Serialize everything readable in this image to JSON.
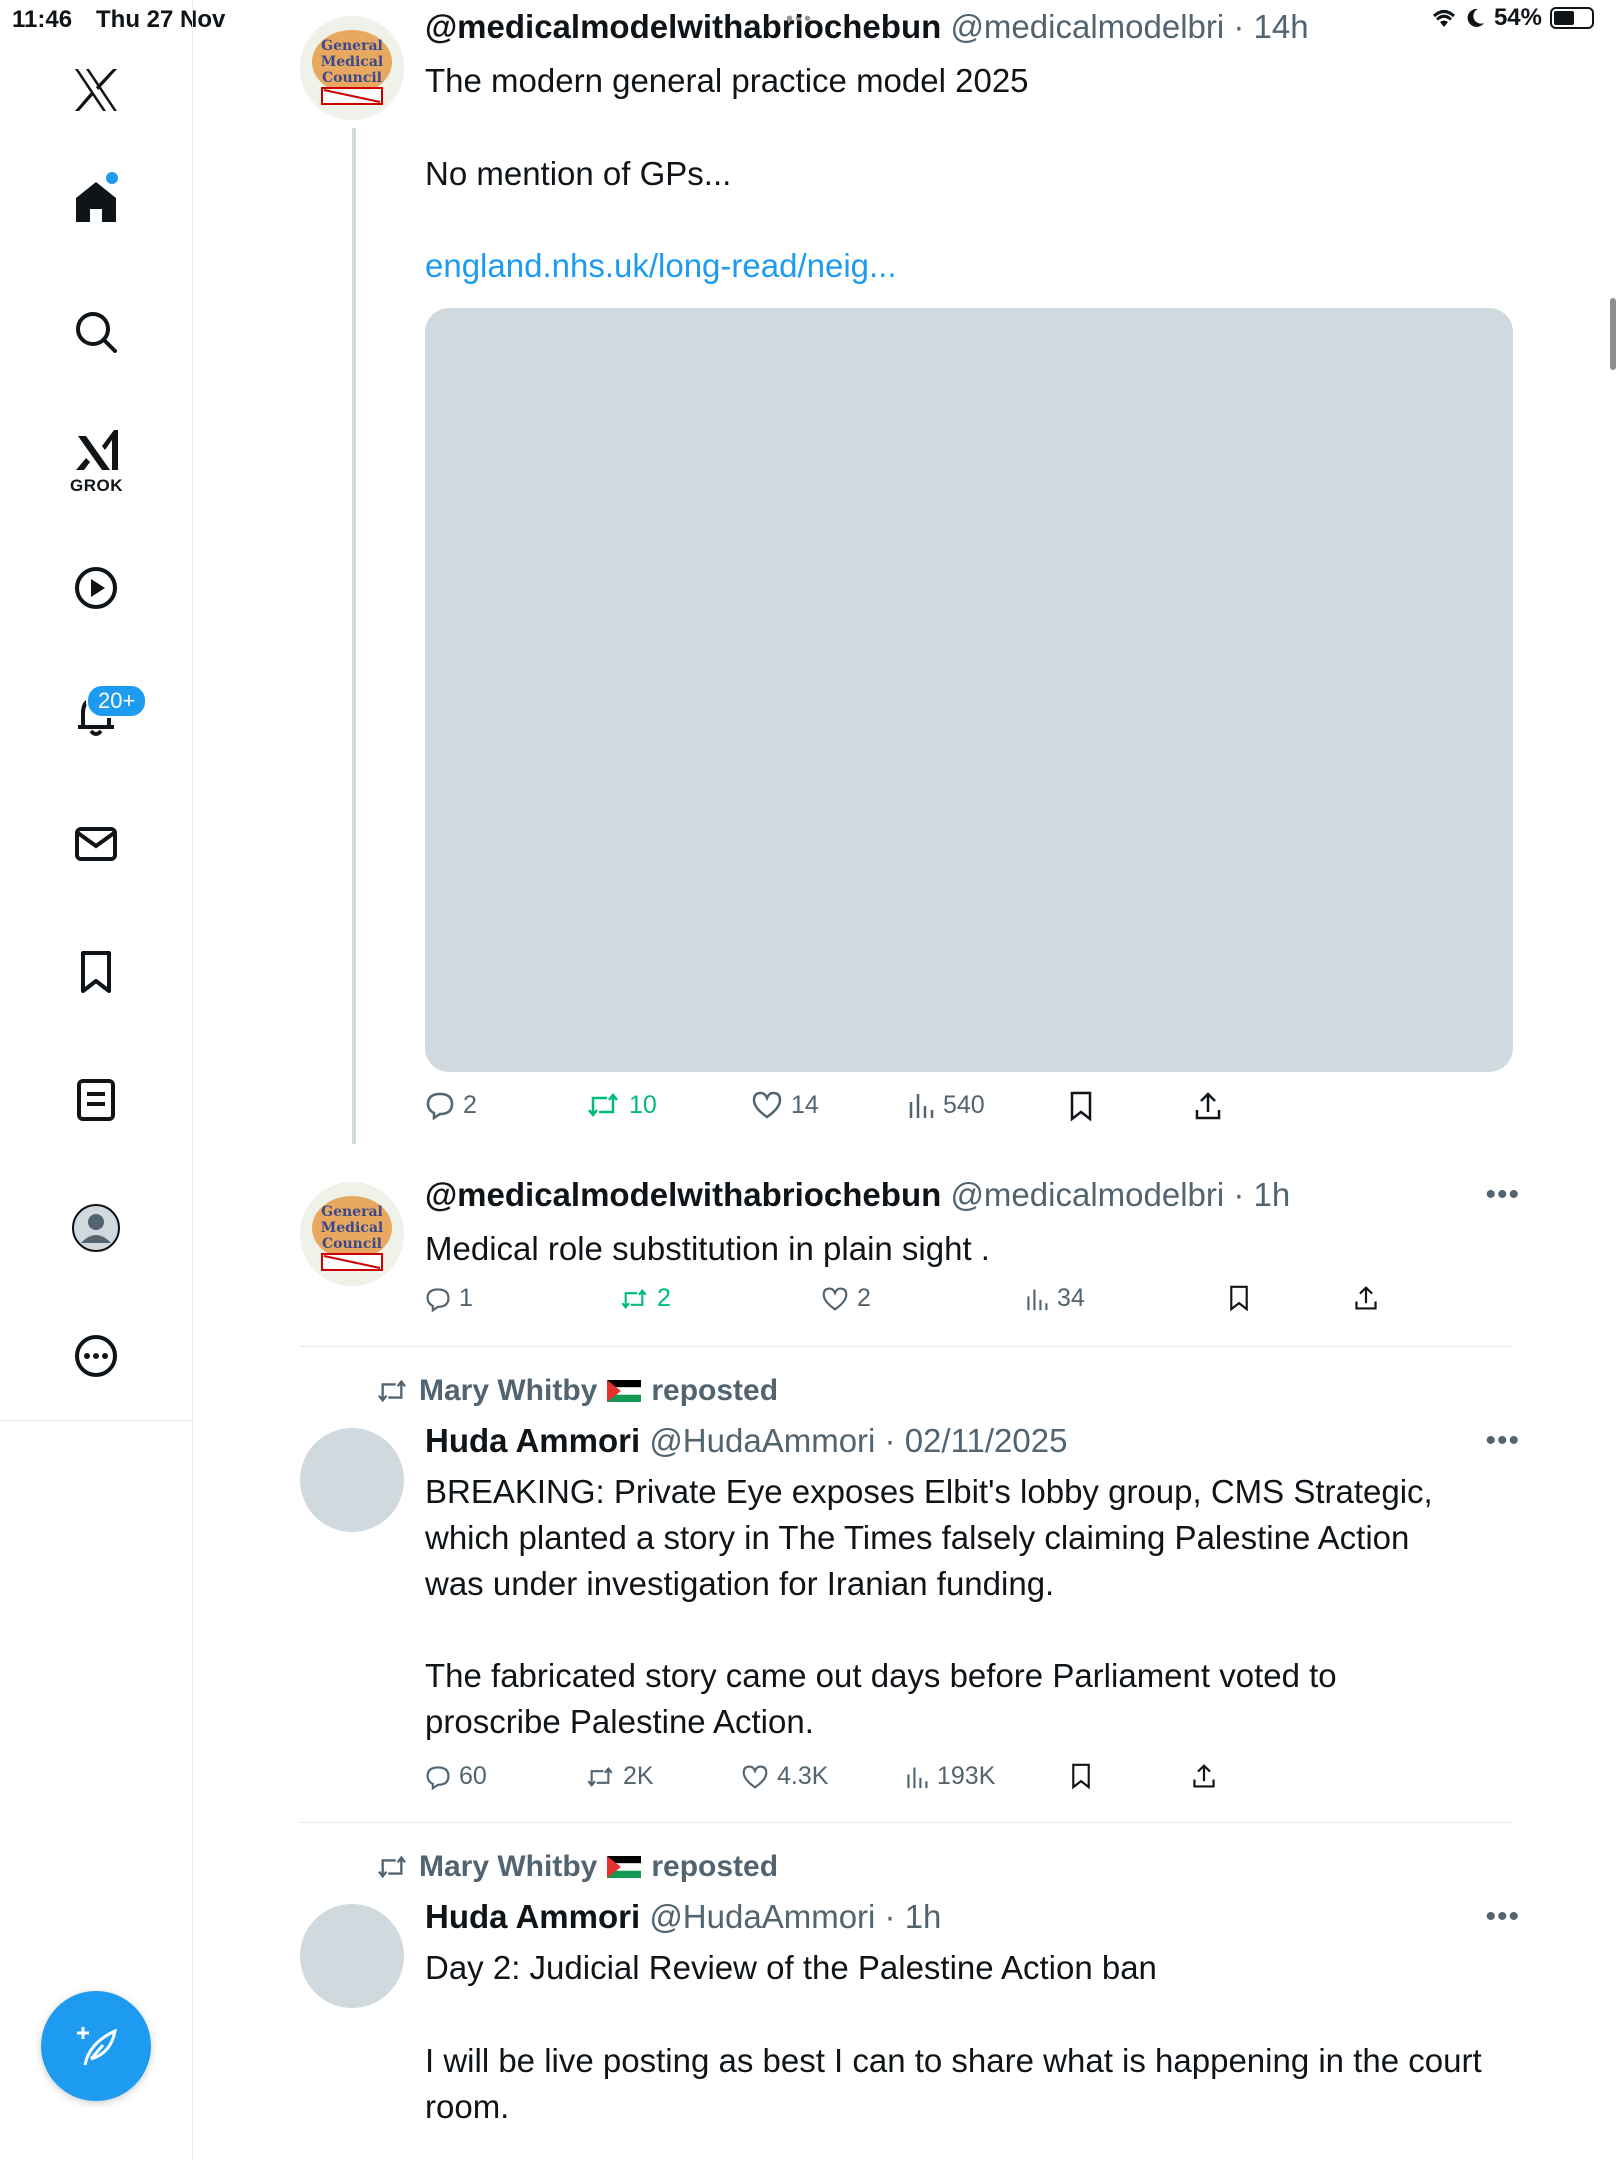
{
  "status_bar": {
    "time": "11:46",
    "date": "Thu 27 Nov",
    "battery": "54%"
  },
  "sidebar": {
    "grok_label": "GROK",
    "notifications_badge": "20+"
  },
  "tweets": [
    {
      "name": "@medicalmodelwithabriochebun",
      "handle": "@medicalmodelbri",
      "time": "· 14h",
      "lines": [
        "The modern general practice model 2025",
        "No mention of GPs..."
      ],
      "link": "england.nhs.uk/long-read/neig...",
      "replies": "2",
      "reposts": "10",
      "likes": "14",
      "views": "540"
    },
    {
      "name": "@medicalmodelwithabriochebun",
      "handle": "@medicalmodelbri",
      "time": "· 1h",
      "text": "Medical role substitution in plain sight .",
      "replies": "1",
      "reposts": "2",
      "likes": "2",
      "views": "34"
    },
    {
      "repost_by": "Mary Whitby",
      "repost_label": "reposted",
      "name": "Huda Ammori",
      "handle": "@HudaAmmori",
      "time": "· 02/11/2025",
      "paragraph1": "BREAKING: Private Eye exposes Elbit's lobby group, CMS Strategic, which planted a story in The Times falsely claiming Palestine Action was under investigation for Iranian funding.",
      "paragraph2": "The fabricated story came out days before Parliament voted to proscribe Palestine Action.",
      "replies": "60",
      "reposts": "2K",
      "likes": "4.3K",
      "views": "193K"
    },
    {
      "repost_by": "Mary Whitby",
      "repost_label": "reposted",
      "name": "Huda Ammori",
      "handle": "@HudaAmmori",
      "time": "· 1h",
      "paragraph1": "Day 2: Judicial Review of the Palestine Action ban",
      "paragraph2": "I will be live posting as best I can to share what is happening in the court room."
    }
  ],
  "colors": {
    "accent": "#1d9bf0",
    "repost_green": "#00ba7c",
    "muted": "#536471"
  },
  "icons": [
    "x-logo-icon",
    "home-icon",
    "search-icon",
    "grok-icon",
    "video-icon",
    "bell-icon",
    "mail-icon",
    "bookmark-icon",
    "list-icon",
    "profile-icon",
    "more-icon",
    "compose-icon"
  ]
}
